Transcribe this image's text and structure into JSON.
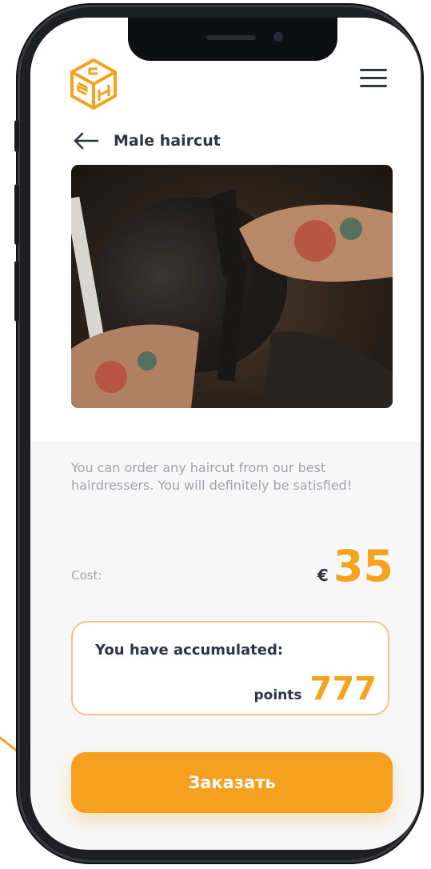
{
  "colors": {
    "accent": "#f4a21f",
    "text": "#2f3540",
    "muted": "#a0a3aa"
  },
  "header": {
    "logo_icon": "gsh-cube-logo",
    "menu_icon": "hamburger-menu-icon"
  },
  "page": {
    "back_icon": "arrow-left-icon",
    "title": "Male haircut"
  },
  "photo": {
    "subject": "barber cutting hair with comb and scissors"
  },
  "description": "You can order any haircut from our best hairdressers. You will definitely be satisfied!",
  "cost": {
    "label": "Cost:",
    "currency": "€",
    "value": "35"
  },
  "points": {
    "title": "You have accumulated:",
    "label": "points",
    "value": "777"
  },
  "order_button": {
    "label": "Заказать"
  }
}
